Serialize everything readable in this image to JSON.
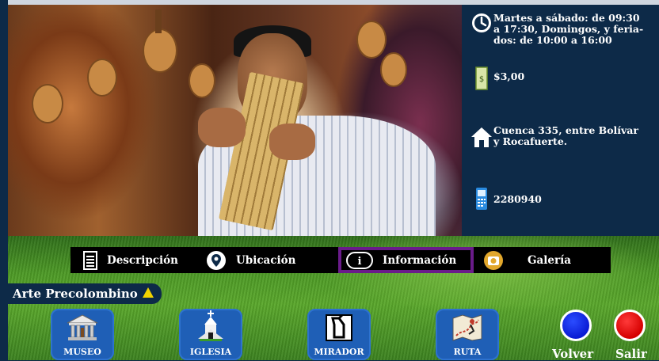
{
  "info": {
    "hours": "Martes a sábado: de 09:30\na 17:30, Domingos, y feria-\ndos: de 10:00 a 16:00",
    "price": "$3,00",
    "address": "Cuenca 335, entre Bolívar\ny Rocafuerte.",
    "phone": "2280940"
  },
  "tabs": [
    {
      "label": "Descripción",
      "icon": "document-icon"
    },
    {
      "label": "Ubicación",
      "icon": "location-pin-icon"
    },
    {
      "label": "Información",
      "icon": "info-icon",
      "active": true
    },
    {
      "label": "Galería",
      "icon": "camera-icon"
    }
  ],
  "section": {
    "title": "Arte Precolombino"
  },
  "categories": [
    {
      "label": "MUSEO",
      "icon": "museum-icon"
    },
    {
      "label": "IGLESIA",
      "icon": "church-icon"
    },
    {
      "label": "MIRADOR",
      "icon": "viewpoint-icon"
    },
    {
      "label": "RUTA",
      "icon": "route-map-icon"
    }
  ],
  "actions": {
    "back_label": "Volver",
    "exit_label": "Salir"
  },
  "colors": {
    "panel": "#0d2a48",
    "tab_active_border": "#6a1b8a",
    "button_blue": "#1f5fb6",
    "back": "#0a1bd4",
    "exit": "#d50000"
  }
}
